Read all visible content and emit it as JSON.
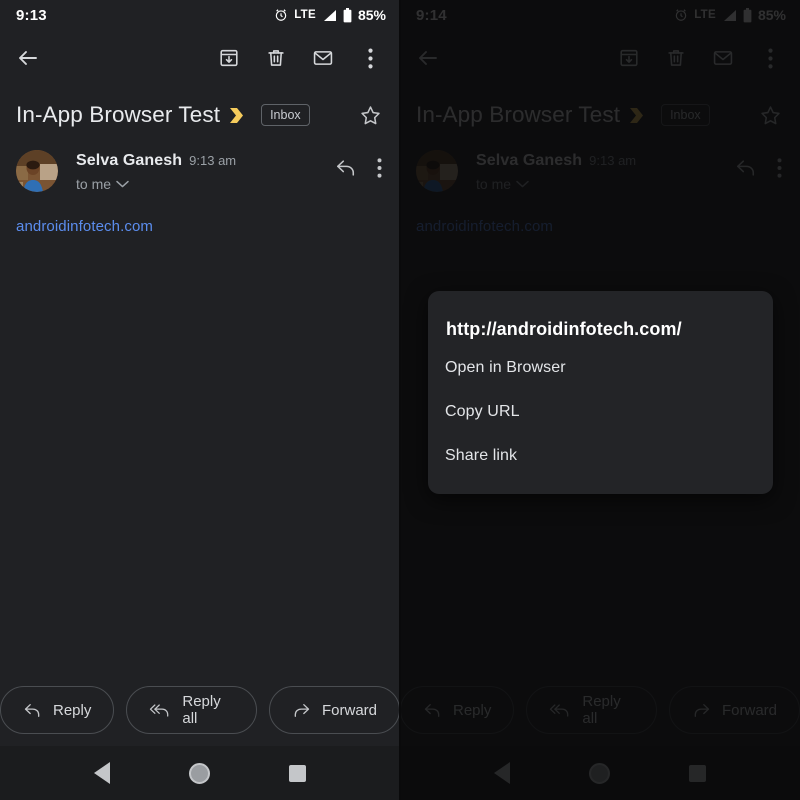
{
  "left": {
    "status_bar": {
      "time": "9:13",
      "network": "LTE",
      "battery": "85%",
      "alarm_icon": "alarm-icon",
      "signal_icon": "signal-icon",
      "battery_icon": "battery-icon"
    },
    "toolbar": {
      "back_icon": "back-arrow-icon",
      "archive_icon": "archive-icon",
      "delete_icon": "trash-icon",
      "unread_icon": "mail-icon",
      "overflow_icon": "more-vertical-icon"
    },
    "subject": {
      "text": "In-App Browser Test",
      "important_icon": "important-chevron-icon",
      "label": "Inbox",
      "star_icon": "star-outline-icon"
    },
    "sender": {
      "avatar": "avatar",
      "name": "Selva Ganesh",
      "time": "9:13 am",
      "recipient": "to me",
      "expand_icon": "chevron-down-icon",
      "reply_icon": "reply-arrow-icon",
      "overflow_icon": "more-vertical-icon"
    },
    "body": {
      "link": "androidinfotech.com"
    },
    "reply_bar": [
      {
        "label": "Reply",
        "icon": "reply-icon"
      },
      {
        "label": "Reply all",
        "icon": "reply-all-icon"
      },
      {
        "label": "Forward",
        "icon": "forward-icon"
      }
    ],
    "nav_bar": {
      "back": "nav-back-icon",
      "home": "nav-home-icon",
      "recents": "nav-recents-icon"
    }
  },
  "right": {
    "status_bar": {
      "time": "9:14",
      "network": "LTE",
      "battery": "85%",
      "alarm_icon": "alarm-icon",
      "signal_icon": "signal-icon",
      "battery_icon": "battery-icon"
    },
    "toolbar": {
      "back_icon": "back-arrow-icon",
      "archive_icon": "archive-icon",
      "delete_icon": "trash-icon",
      "unread_icon": "mail-icon",
      "overflow_icon": "more-vertical-icon"
    },
    "subject": {
      "text": "In-App Browser Test",
      "important_icon": "important-chevron-icon",
      "label": "Inbox",
      "star_icon": "star-outline-icon"
    },
    "sender": {
      "avatar": "avatar",
      "name": "Selva Ganesh",
      "time": "9:13 am",
      "recipient": "to me",
      "expand_icon": "chevron-down-icon",
      "reply_icon": "reply-arrow-icon",
      "overflow_icon": "more-vertical-icon"
    },
    "body": {
      "link": "androidinfotech.com"
    },
    "reply_bar": [
      {
        "label": "Reply",
        "icon": "reply-icon"
      },
      {
        "label": "Reply all",
        "icon": "reply-all-icon"
      },
      {
        "label": "Forward",
        "icon": "forward-icon"
      }
    ],
    "nav_bar": {
      "back": "nav-back-icon",
      "home": "nav-home-icon",
      "recents": "nav-recents-icon"
    },
    "dialog": {
      "title": "http://androidinfotech.com/",
      "items": [
        {
          "label": "Open in Browser"
        },
        {
          "label": "Copy URL"
        },
        {
          "label": "Share link"
        }
      ]
    }
  },
  "colors": {
    "background": "#202124",
    "dialog": "#232427",
    "link": "#5b8dee",
    "important": "#f5cb5c",
    "primary_text": "#e8eaed",
    "secondary_text": "#9aa0a6"
  }
}
